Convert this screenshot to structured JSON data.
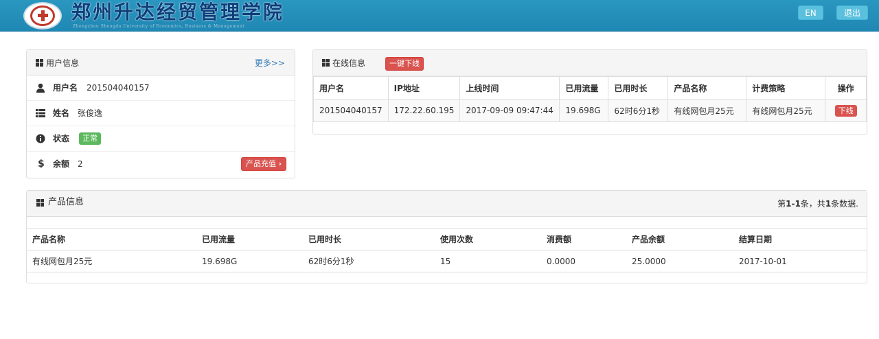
{
  "header": {
    "logo_title": "郑州升达经贸管理学院",
    "logo_subtitle": "Zhengzhou Shengda University of Economics, Business & Management",
    "lang_button": "EN",
    "exit_button": "退出"
  },
  "user_panel": {
    "title": "用户信息",
    "more_link": "更多>>",
    "rows": {
      "username": {
        "label": "用户名",
        "value": "201504040157"
      },
      "name": {
        "label": "姓名",
        "value": "张俊逸"
      },
      "status": {
        "label": "状态",
        "value": "正常"
      },
      "balance": {
        "label": "余额",
        "value": "2",
        "action": "产品充值"
      }
    }
  },
  "online_panel": {
    "title": "在线信息",
    "kick_all_button": "一键下线",
    "columns": [
      "用户名",
      "IP地址",
      "上线时间",
      "已用流量",
      "已用时长",
      "产品名称",
      "计费策略",
      "操作"
    ],
    "row": {
      "username": "201504040157",
      "ip": "172.22.60.195",
      "online_time": "2017-09-09 09:47:44",
      "used_traffic": "19.698G",
      "used_duration": "62时6分1秒",
      "product": "有线网包月25元",
      "billing": "有线网包月25元",
      "action": "下线"
    }
  },
  "product_panel": {
    "title": "产品信息",
    "count_prefix": "第",
    "count_range": "1-1",
    "count_middle": "条，共",
    "count_total": "1",
    "count_suffix": "条数据.",
    "columns": [
      "产品名称",
      "已用流量",
      "已用时长",
      "使用次数",
      "消费额",
      "产品余额",
      "结算日期"
    ],
    "row": {
      "product": "有线网包月25元",
      "used_traffic": "19.698G",
      "used_duration": "62时6分1秒",
      "use_count": "15",
      "consumption": "0.0000",
      "product_balance": "25.0000",
      "settle_date": "2017-10-01"
    }
  },
  "colors": {
    "header_bg": "#1f87b3",
    "info_btn": "#5bc0de",
    "danger": "#d9534f",
    "success": "#5cb85c",
    "link": "#337ab7"
  }
}
